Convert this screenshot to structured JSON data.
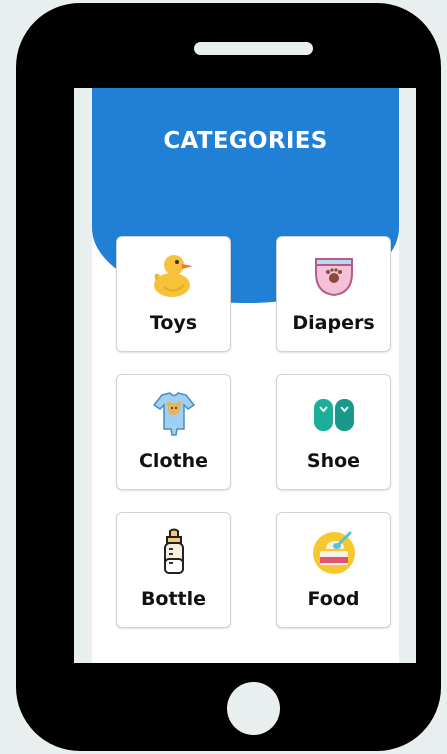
{
  "header": {
    "title": "CATEGORIES"
  },
  "categories": [
    {
      "label": "Toys",
      "icon": "duck-icon"
    },
    {
      "label": "Diapers",
      "icon": "diaper-icon"
    },
    {
      "label": "Clothe",
      "icon": "onesie-icon"
    },
    {
      "label": "Shoe",
      "icon": "shoe-icon"
    },
    {
      "label": "Bottle",
      "icon": "baby-bottle-icon"
    },
    {
      "label": "Food",
      "icon": "baby-food-icon"
    }
  ],
  "colors": {
    "header_blue": "#1f80d6",
    "phone_body": "#000000",
    "background": "#e9eeef"
  }
}
